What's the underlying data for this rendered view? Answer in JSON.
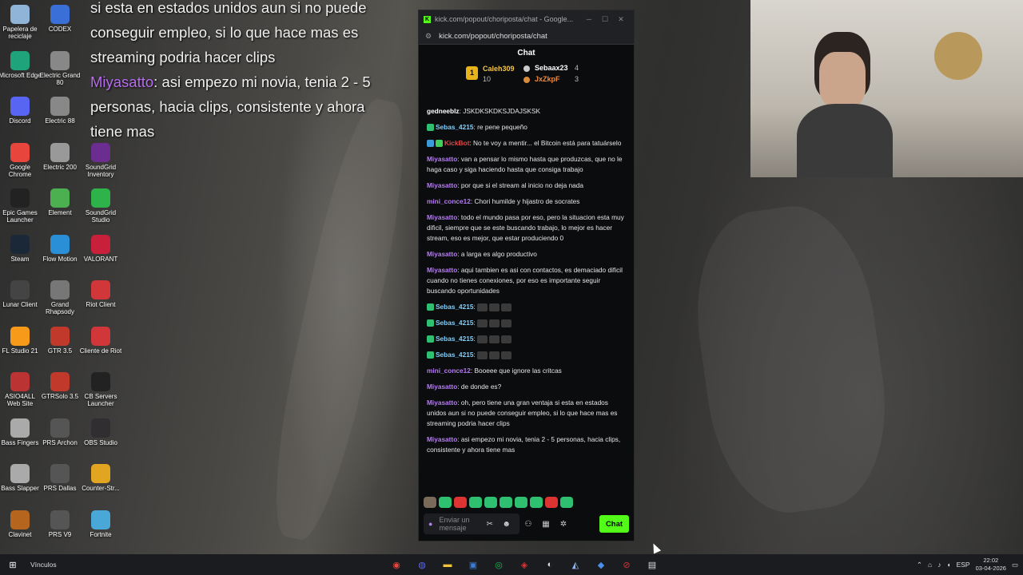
{
  "overlay": {
    "line1": "si esta en estados unidos aun si no puede",
    "line2": "conseguir empleo, si lo que hace mas es",
    "line3": "streaming podria hacer clips",
    "user": "Miyasatto",
    "line4": "asi empezo mi novia, tenia 2 - 5",
    "line5": "personas, hacia clips, consistente y ahora",
    "line6": "tiene mas"
  },
  "desktop_icons": [
    {
      "label": "Papelera de reciclaje",
      "icon": "recycle-bin-icon",
      "color": "#8fb4d8"
    },
    {
      "label": "CODEX",
      "icon": "codex-icon",
      "color": "#3a6fd8"
    },
    {
      "label": "Microsoft Edge",
      "icon": "edge-icon",
      "color": "#1fa37a"
    },
    {
      "label": "Electric Grand 80",
      "icon": "electric-grand-icon",
      "color": "#888"
    },
    {
      "label": "Discord",
      "icon": "discord-icon",
      "color": "#5865f2"
    },
    {
      "label": "Electric 88",
      "icon": "electric-88-icon",
      "color": "#888"
    },
    {
      "label": "Google Chrome",
      "icon": "chrome-icon",
      "color": "#e8453c"
    },
    {
      "label": "Electric 200",
      "icon": "electric-200-icon",
      "color": "#999"
    },
    {
      "label": "SoundGrid Inventory",
      "icon": "soundgrid-icon",
      "color": "#6b2d8f"
    },
    {
      "label": "Epic Games Launcher",
      "icon": "epic-games-icon",
      "color": "#222"
    },
    {
      "label": "Element",
      "icon": "element-icon",
      "color": "#4caf50"
    },
    {
      "label": "SoundGrid Studio",
      "icon": "soundgrid-studio-icon",
      "color": "#2db34a"
    },
    {
      "label": "Steam",
      "icon": "steam-icon",
      "color": "#1b2838"
    },
    {
      "label": "Flow Motion",
      "icon": "flow-motion-icon",
      "color": "#2a8fd6"
    },
    {
      "label": "VALORANT",
      "icon": "valorant-icon",
      "color": "#c8203b"
    },
    {
      "label": "Lunar Client",
      "icon": "lunar-client-icon",
      "color": "#444"
    },
    {
      "label": "Grand Rhapsody",
      "icon": "grand-rhapsody-icon",
      "color": "#777"
    },
    {
      "label": "Riot Client",
      "icon": "riot-client-icon",
      "color": "#d13639"
    },
    {
      "label": "FL Studio 21",
      "icon": "fl-studio-icon",
      "color": "#f79a1a"
    },
    {
      "label": "GTR 3.5",
      "icon": "gtr-icon",
      "color": "#c0392b"
    },
    {
      "label": "Cliente de Riot",
      "icon": "cliente-riot-icon",
      "color": "#d13639"
    },
    {
      "label": "ASIO4ALL Web Site",
      "icon": "asio4all-icon",
      "color": "#b33"
    },
    {
      "label": "GTRSolo 3.5",
      "icon": "gtrsolo-icon",
      "color": "#c0392b"
    },
    {
      "label": "CB Servers Launcher",
      "icon": "cb-servers-icon",
      "color": "#222"
    },
    {
      "label": "Bass Fingers",
      "icon": "bass-fingers-icon",
      "color": "#aaa"
    },
    {
      "label": "PRS Archon",
      "icon": "prs-archon-icon",
      "color": "#555"
    },
    {
      "label": "OBS Studio",
      "icon": "obs-icon",
      "color": "#302e31"
    },
    {
      "label": "Bass Slapper",
      "icon": "bass-slapper-icon",
      "color": "#aaa"
    },
    {
      "label": "PRS Dallas",
      "icon": "prs-dallas-icon",
      "color": "#555"
    },
    {
      "label": "Counter-Str...",
      "icon": "counter-strike-icon",
      "color": "#e2a522"
    },
    {
      "label": "Clavinet",
      "icon": "clavinet-icon",
      "color": "#b5651d"
    },
    {
      "label": "PRS V9",
      "icon": "prs-v9-icon",
      "color": "#555"
    },
    {
      "label": "Fortnite",
      "icon": "fortnite-icon",
      "color": "#4aa8d8"
    }
  ],
  "window": {
    "title": "kick.com/popout/choriposta/chat - Google...",
    "url": "kick.com/popout/choriposta/chat",
    "header": "Chat",
    "accent": "#53fc18"
  },
  "leaders": {
    "first": {
      "name": "Caleh309",
      "count": "10"
    },
    "second": {
      "name": "Sebaax23",
      "count": "4"
    },
    "third": {
      "name": "JxZkpF",
      "count": "3"
    }
  },
  "messages": [
    {
      "user": "gedneeblz",
      "color": "u-white",
      "text": "JSKDKSKDKSJDAJSKSK"
    },
    {
      "user": "Sebas_4215",
      "color": "u-teal",
      "text": "re pene pequeño"
    },
    {
      "user": "KickBot",
      "color": "u-red",
      "text": "No te voy a mentir... el Bitcoin está para tatuárselo"
    },
    {
      "user": "Miyasatto",
      "color": "u-purple",
      "text": "van a pensar lo mismo hasta que produzcas, que no le haga caso y siga haciendo hasta que consiga trabajo"
    },
    {
      "user": "Miyasatto",
      "color": "u-purple",
      "text": "por que si el stream al inicio no deja nada"
    },
    {
      "user": "mini_conce12",
      "color": "u-purple",
      "text": "Chori humilde y hijastro de socrates"
    },
    {
      "user": "Miyasatto",
      "color": "u-purple",
      "text": "todo el mundo pasa por eso, pero la situacion esta muy dificil, siempre que se este buscando trabajo, lo mejor es hacer stream, eso es mejor, que estar produciendo 0"
    },
    {
      "user": "Miyasatto",
      "color": "u-purple",
      "text": "a larga es algo productivo"
    },
    {
      "user": "Miyasatto",
      "color": "u-purple",
      "text": "aqui tambien es asi con contactos, es demaciado dificil cuando no tienes conexiones, por eso es importante seguir buscando oportunidades"
    },
    {
      "user": "Sebas_4215",
      "color": "u-teal",
      "text": ""
    },
    {
      "user": "Sebas_4215",
      "color": "u-teal",
      "text": ""
    },
    {
      "user": "Sebas_4215",
      "color": "u-teal",
      "text": ""
    },
    {
      "user": "Sebas_4215",
      "color": "u-teal",
      "text": ""
    },
    {
      "user": "mini_conce12",
      "color": "u-purple",
      "text": "Booeee que ignore las critcas"
    },
    {
      "user": "Miyasatto",
      "color": "u-purple",
      "text": "de donde es?"
    },
    {
      "user": "Miyasatto",
      "color": "u-purple",
      "text": "oh, pero tiene una gran ventaja si esta en estados unidos aun si no puede conseguir empleo, si lo que hace mas es streaming podria hacer clips"
    },
    {
      "user": "Miyasatto",
      "color": "u-purple",
      "text": "asi empezo mi novia, tenia 2 - 5 personas, hacia clips, consistente y ahora tiene mas"
    }
  ],
  "input": {
    "placeholder": "Enviar un mensaje",
    "send_label": "Chat"
  },
  "taskbar": {
    "search_label": "Vínculos",
    "lang": "ESP",
    "time": "22:02",
    "date": "03-04-2026"
  }
}
